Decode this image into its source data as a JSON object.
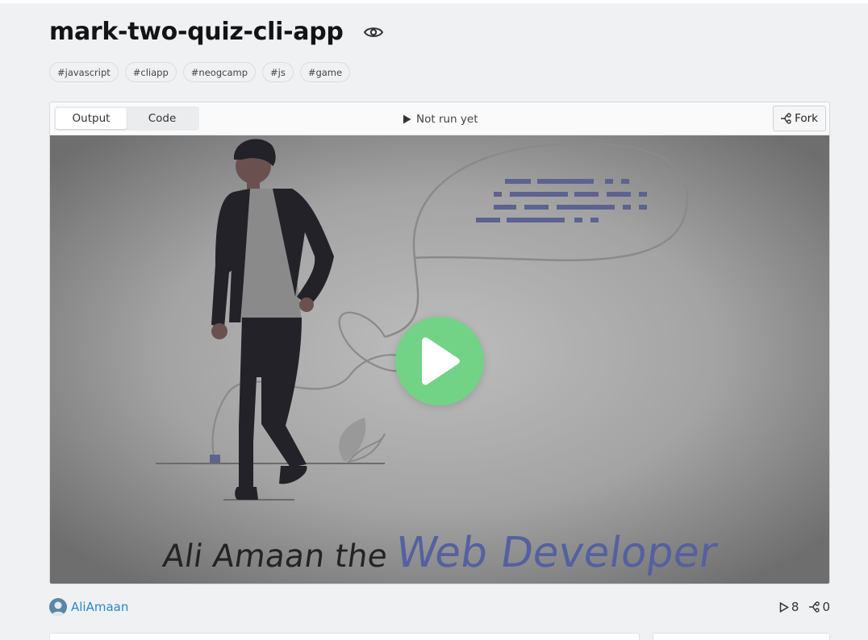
{
  "project": {
    "title": "mark-two-quiz-cli-app"
  },
  "tags": [
    "#javascript",
    "#cliapp",
    "#neogcamp",
    "#js",
    "#game"
  ],
  "toolbar": {
    "tabs": [
      {
        "label": "Output",
        "active": true
      },
      {
        "label": "Code",
        "active": false
      }
    ],
    "run_status": "Not run yet",
    "fork_label": "Fork"
  },
  "preview": {
    "caption_plain": "Ali Amaan the",
    "caption_accent": "Web Developer",
    "play_color": "#72d386",
    "accent_color": "#5460a0"
  },
  "footer": {
    "author": "AliAmaan",
    "runs": "8",
    "forks": "0"
  },
  "icons": {
    "visibility": "eye-icon",
    "run": "play-triangle-icon",
    "fork": "fork-icon"
  }
}
